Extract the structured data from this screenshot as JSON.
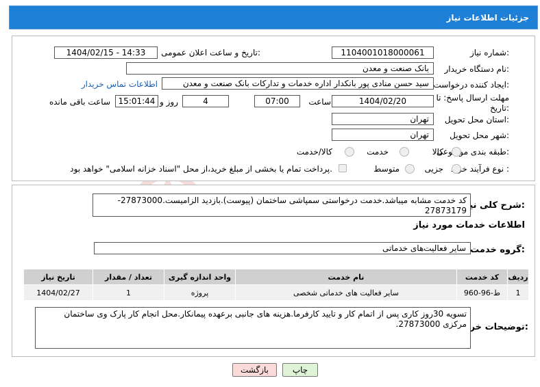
{
  "header": {
    "title": "جزئیات اطلاعات نیاز"
  },
  "fields": {
    "need_number_label": "شماره نیاز:",
    "need_number": "1104001018000061",
    "announce_label": "تاریخ و ساعت اعلان عمومی:",
    "announce_value": "1404/02/15 - 14:33",
    "buyer_org_label": "نام دستگاه خریدار:",
    "buyer_org": "بانک صنعت و معدن",
    "requester_label": "ایجاد کننده درخواست:",
    "requester": "سید حسن منادی پور بانکدار اداره خدمات و تدارکات بانک صنعت و معدن",
    "contact_link": "اطلاعات تماس خریدار",
    "deadline_label_1": "مهلت ارسال پاسخ: تا",
    "deadline_label_2": "تاریخ:",
    "deadline_date": "1404/02/20",
    "time_label": "ساعت",
    "deadline_time": "07:00",
    "days_value": "4",
    "days_label": "روز و",
    "remaining_time": "15:01:44",
    "remaining_label": "ساعت باقی مانده",
    "province_label": "استان محل تحویل:",
    "province": "تهران",
    "city_label": "شهر محل تحویل:",
    "city": "تهران",
    "category_label": "طبقه بندی موضوعی:",
    "category_options": [
      "کالا",
      "خدمت",
      "کالا/خدمت"
    ],
    "process_label": "نوع فرآیند خرید :",
    "process_options": [
      "جزیی",
      "متوسط"
    ],
    "payment_note": "پرداخت تمام یا بخشی از مبلغ خرید،از محل \"اسناد خزانه اسلامی\" خواهد بود."
  },
  "summary": {
    "label": "شرح کلی نیاز:",
    "text": "کد خدمت مشابه میباشد.خدمت درخواستی سمپاشی ساختمان (پیوست).بازدید الزامیست.27873000-27873179"
  },
  "services_heading": "اطلاعات خدمات مورد نیاز",
  "service_group": {
    "label": "گروه خدمت:",
    "value": "سایر فعالیت‌های خدماتی"
  },
  "table": {
    "headers": [
      "ردیف",
      "کد خدمت",
      "نام خدمت",
      "واحد اندازه گیری",
      "تعداد / مقدار",
      "تاریخ نیاز"
    ],
    "rows": [
      [
        "1",
        "ط-96-960",
        "سایر فعالیت های خدماتی شخصی",
        "پروژه",
        "1",
        "1404/02/27"
      ]
    ]
  },
  "buyer_notes": {
    "label": "توضیحات خریدار:",
    "text": "تسویه 30روز کاری پس از اتمام کار و تایید کارفرما.هزینه های جانبی برعهده پیمانکار.محل انجام کار پارک وی ساختمان مرکزی 27873000."
  },
  "buttons": {
    "print": "چاپ",
    "back": "بازگشت"
  },
  "colors": {
    "title_bar": "#1e7fd6",
    "link": "#1a5fb4",
    "print_button": "#dff3d6",
    "back_button": "#fbdada"
  }
}
